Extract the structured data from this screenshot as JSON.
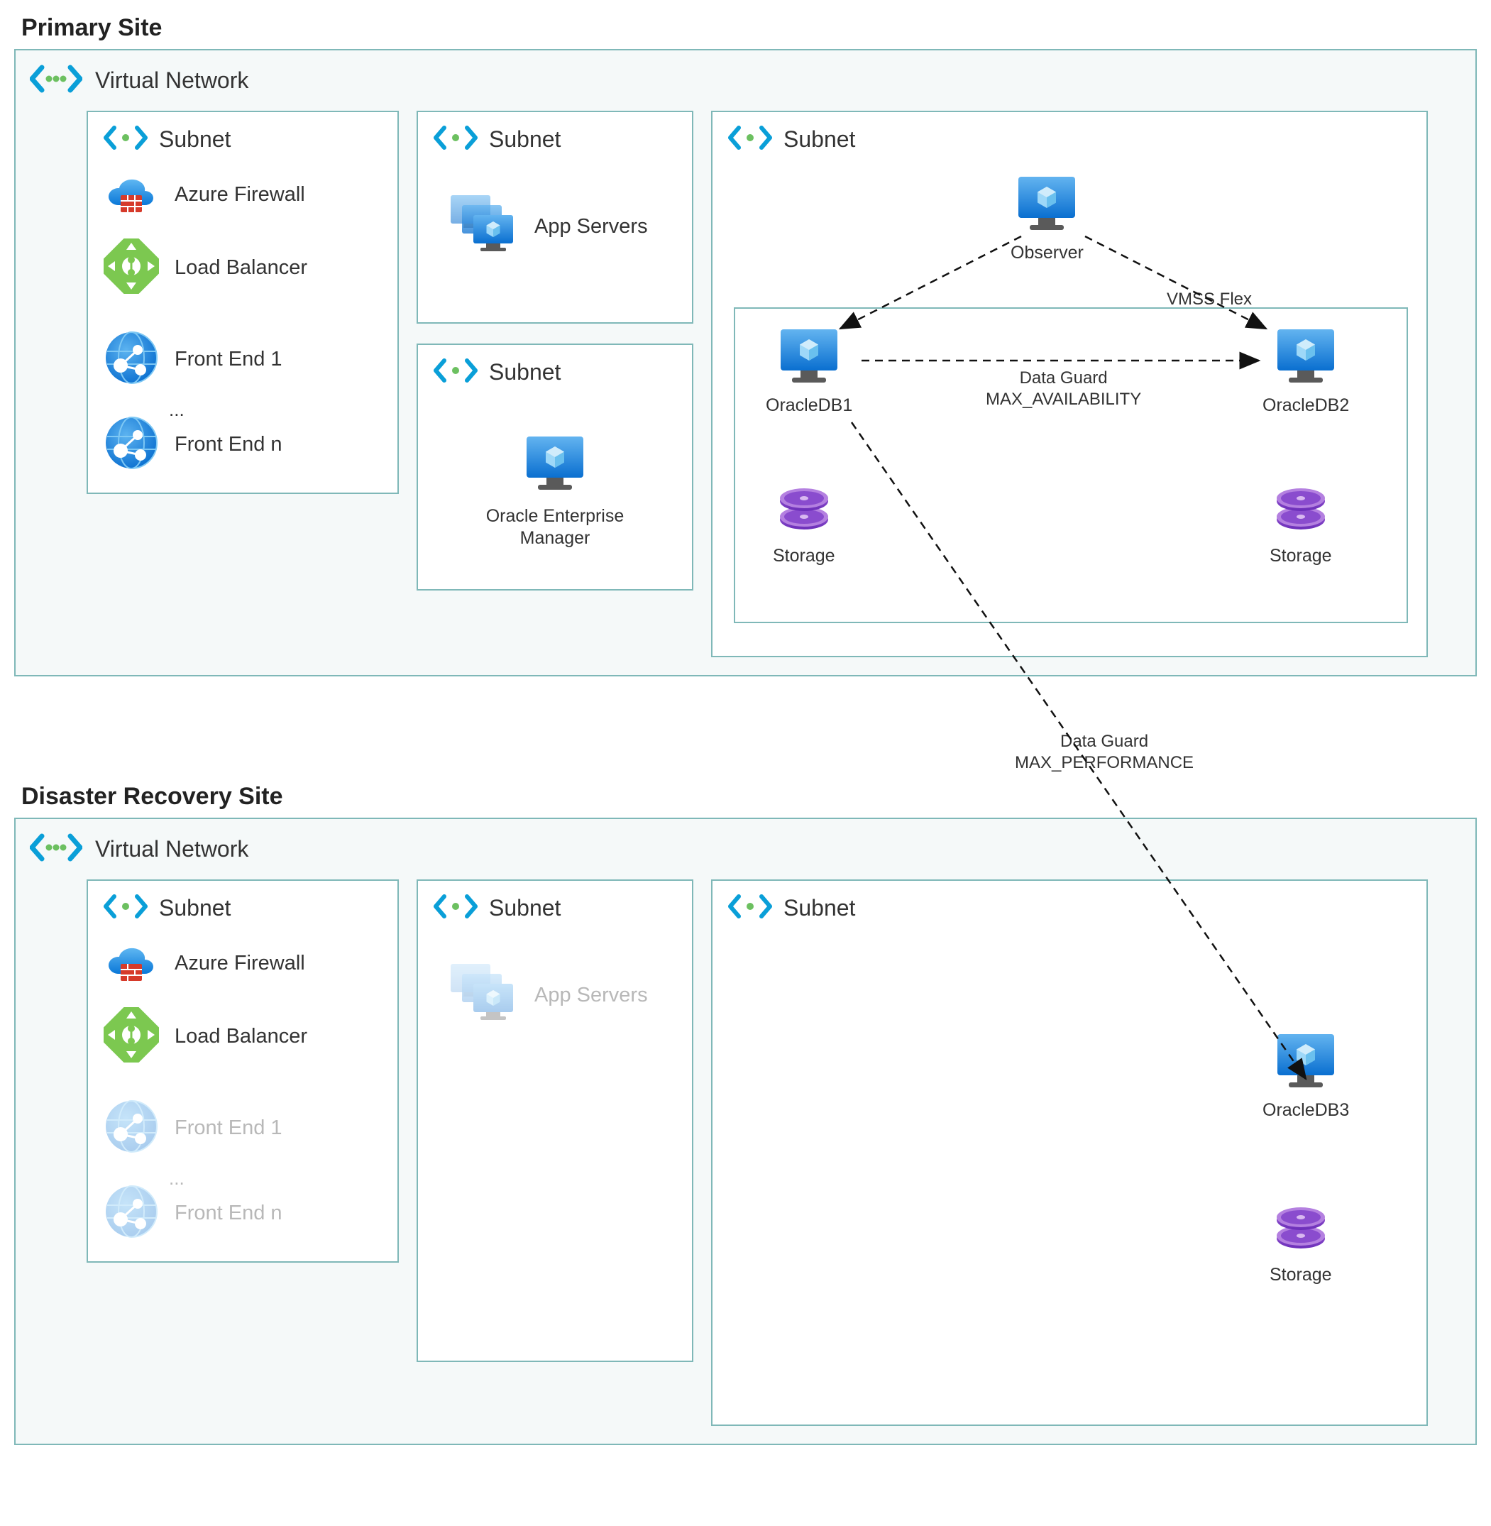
{
  "primary": {
    "title": "Primary Site",
    "vnet": "Virtual Network",
    "subnet_label": "Subnet",
    "firewall": "Azure Firewall",
    "load_balancer": "Load Balancer",
    "frontend1": "Front End 1",
    "ellipsis": "...",
    "frontendn": "Front End n",
    "app_servers": "App Servers",
    "oem": "Oracle Enterprise Manager",
    "observer": "Observer",
    "oracledb1": "OracleDB1",
    "oracledb2": "OracleDB2",
    "storage": "Storage",
    "vmss": "VMSS Flex",
    "dg_avail_1": "Data Guard",
    "dg_avail_2": "MAX_AVAILABILITY"
  },
  "dr": {
    "title": "Disaster Recovery Site",
    "vnet": "Virtual Network",
    "subnet_label": "Subnet",
    "firewall": "Azure Firewall",
    "load_balancer": "Load Balancer",
    "frontend1": "Front End 1",
    "ellipsis": "...",
    "frontendn": "Front End n",
    "app_servers": "App Servers",
    "oracledb3": "OracleDB3",
    "storage": "Storage"
  },
  "inter": {
    "dg_perf_1": "Data Guard",
    "dg_perf_2": "MAX_PERFORMANCE"
  }
}
